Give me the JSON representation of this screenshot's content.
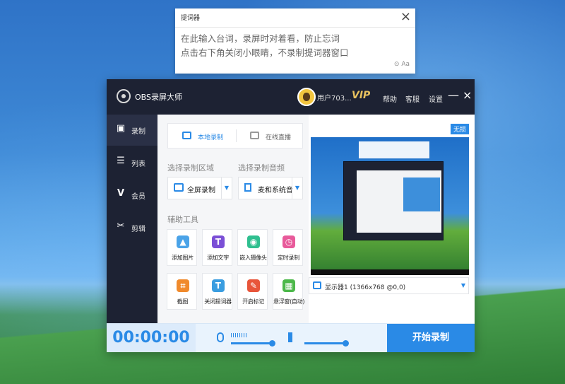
{
  "prompter": {
    "title": "提词器",
    "close": "×",
    "line1": "在此输入台词，录屏时对着看，防止忘词",
    "line2": "点击右下角关闭小眼睛，不录制提词器窗口",
    "footer": "⊙ Aa"
  },
  "app": {
    "title": "OBS录屏大师",
    "username": "用户703...",
    "vip": "VIP",
    "help": "帮助",
    "service": "客服",
    "settings": "设置",
    "minimize": "—",
    "close": "×"
  },
  "sidebar": {
    "items": [
      {
        "label": "录制",
        "icon": "record-icon",
        "glyph": "▣"
      },
      {
        "label": "列表",
        "icon": "list-icon",
        "glyph": "☰"
      },
      {
        "label": "会员",
        "icon": "vip-icon",
        "glyph": "V"
      },
      {
        "label": "剪辑",
        "icon": "scissors-icon",
        "glyph": "✂"
      }
    ]
  },
  "modes": {
    "local": "本地录制",
    "live": "在线直播"
  },
  "region": {
    "label": "选择录制区域",
    "value": "全屏录制"
  },
  "audio": {
    "label": "选择录制音频",
    "value": "麦和系统音"
  },
  "tools": {
    "label": "辅助工具",
    "items": [
      {
        "label": "添加图片",
        "icon": "add-image-icon",
        "glyph": "▲",
        "color": "#4aa3e8"
      },
      {
        "label": "添加文字",
        "icon": "add-text-icon",
        "glyph": "T",
        "color": "#7b4fd6"
      },
      {
        "label": "嵌入摄像头",
        "icon": "camera-icon",
        "glyph": "◉",
        "color": "#2fbf8f"
      },
      {
        "label": "定时录制",
        "icon": "timer-icon",
        "glyph": "◷",
        "color": "#e85a9a"
      },
      {
        "label": "截图",
        "icon": "crop-icon",
        "glyph": "⌗",
        "color": "#f08a2c"
      },
      {
        "label": "关闭提词器",
        "icon": "prompter-icon",
        "glyph": "T",
        "color": "#3a9de0"
      },
      {
        "label": "开启标记",
        "icon": "marker-icon",
        "glyph": "✎",
        "color": "#e8553a"
      },
      {
        "label": "悬浮窗(自动)",
        "icon": "float-window-icon",
        "glyph": "▦",
        "color": "#4cb84a"
      }
    ]
  },
  "preview": {
    "badge": "无损",
    "display": "显示器1 (1366x768 @0,0)"
  },
  "bottom": {
    "timer": "00:00:00",
    "mic_level": 1.0,
    "speaker_level": 1.0,
    "start": "开始录制"
  }
}
